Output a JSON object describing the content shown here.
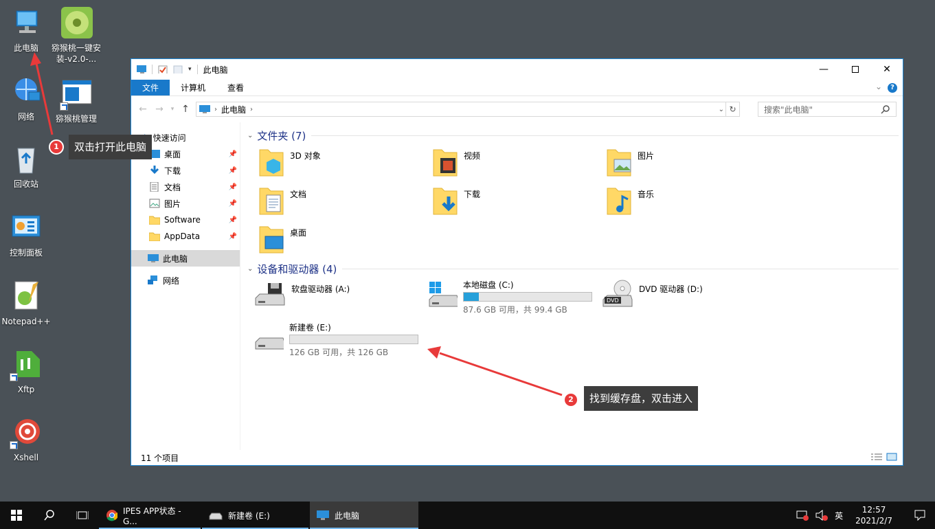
{
  "desktop": {
    "icons": [
      {
        "label": "此电脑"
      },
      {
        "label": "猕猴桃一键安装-v2.0-..."
      },
      {
        "label": "网络"
      },
      {
        "label": "猕猴桃管理"
      },
      {
        "label": "回收站"
      },
      {
        "label": "控制面板"
      },
      {
        "label": "Notepad++"
      },
      {
        "label": "Xftp"
      },
      {
        "label": "Xshell"
      }
    ]
  },
  "callouts": [
    {
      "num": "1",
      "text": "双击打开此电脑"
    },
    {
      "num": "2",
      "text": "找到缓存盘，双击进入"
    }
  ],
  "window": {
    "title": "此电脑",
    "ribbon_tabs": [
      "文件",
      "计算机",
      "查看"
    ],
    "address": {
      "path": "此电脑"
    },
    "search_placeholder": "搜索\"此电脑\"",
    "nav": {
      "quick_access": "快速访问",
      "items": [
        "桌面",
        "下载",
        "文档",
        "图片",
        "Software",
        "AppData"
      ],
      "this_pc": "此电脑",
      "network": "网络"
    },
    "folders_header": "文件夹 (7)",
    "folders": [
      "3D 对象",
      "视频",
      "图片",
      "文档",
      "下载",
      "音乐",
      "桌面"
    ],
    "devices_header": "设备和驱动器 (4)",
    "drives": [
      {
        "name": "软盘驱动器 (A:)"
      },
      {
        "name": "本地磁盘 (C:)",
        "space": "87.6 GB 可用，共 99.4 GB",
        "used_fraction": 0.12
      },
      {
        "name": "DVD 驱动器 (D:)"
      },
      {
        "name": "新建卷 (E:)",
        "space": "126 GB 可用，共 126 GB",
        "used_fraction": 0.0
      }
    ],
    "status": "11 个项目"
  },
  "taskbar": {
    "apps": [
      {
        "label": "IPES APP状态 - G..."
      },
      {
        "label": "新建卷 (E:)"
      },
      {
        "label": "此电脑"
      }
    ],
    "ime": "英",
    "time": "12:57",
    "date": "2021/2/7"
  },
  "colors": {
    "accent": "#1979ca",
    "callout_badge": "#e83a3a",
    "arrow": "#e83a3a",
    "drive_bar": "#26a0da"
  }
}
